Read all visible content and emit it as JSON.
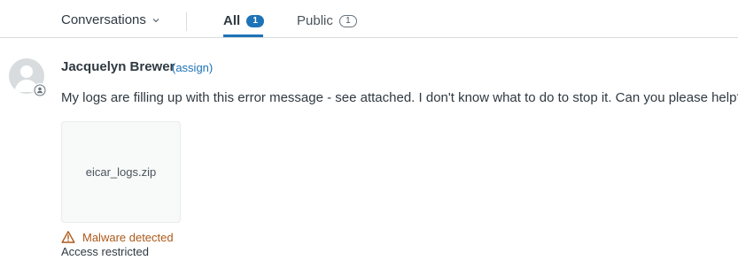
{
  "tabbar": {
    "conversations_label": "Conversations",
    "tabs": [
      {
        "label": "All",
        "count": "1",
        "active": true
      },
      {
        "label": "Public",
        "count": "1",
        "active": false
      }
    ]
  },
  "message": {
    "author": "Jacquelyn Brewer",
    "assign_label": "(assign)",
    "body": "My logs are filling up with this error message - see attached. I don't know what to do to stop it. Can you please help?"
  },
  "attachment": {
    "filename": "eicar_logs.zip",
    "warning": "Malware detected",
    "status": "Access restricted"
  },
  "icons": {
    "dropdown": "chevron-down-icon",
    "avatar": "user-avatar-icon",
    "avatar_badge": "person-badge-icon",
    "warning": "warning-triangle-icon"
  },
  "colors": {
    "accent": "#1f73b7",
    "warning": "#ad5918",
    "text": "#2f3941",
    "border": "#d8dcde"
  }
}
